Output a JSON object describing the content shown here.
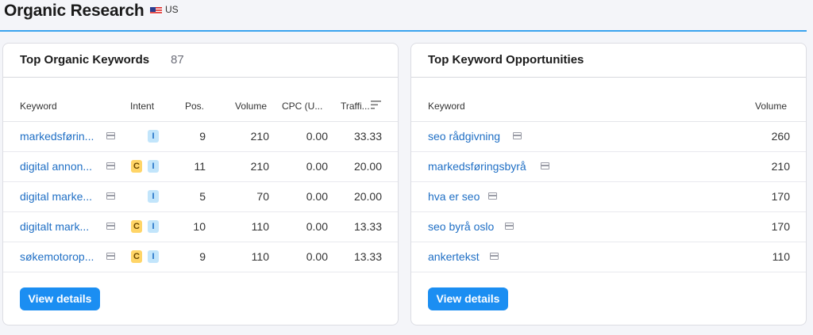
{
  "header": {
    "title": "Organic Research",
    "country": "US",
    "flag_icon": "us-flag-icon",
    "accent_color": "#3aa3ee"
  },
  "organic_keywords": {
    "title": "Top Organic Keywords",
    "count": "87",
    "columns": [
      "Keyword",
      "Intent",
      "Pos.",
      "Volume",
      "CPC (U...",
      "Traffi..."
    ],
    "rows": [
      {
        "keyword": "markedsførin...",
        "intents": [
          "I"
        ],
        "pos": "9",
        "volume": "210",
        "cpc": "0.00",
        "traffic": "33.33"
      },
      {
        "keyword": "digital annon...",
        "intents": [
          "C",
          "I"
        ],
        "pos": "11",
        "volume": "210",
        "cpc": "0.00",
        "traffic": "20.00"
      },
      {
        "keyword": "digital marke...",
        "intents": [
          "I"
        ],
        "pos": "5",
        "volume": "70",
        "cpc": "0.00",
        "traffic": "20.00"
      },
      {
        "keyword": "digitalt mark...",
        "intents": [
          "C",
          "I"
        ],
        "pos": "10",
        "volume": "110",
        "cpc": "0.00",
        "traffic": "13.33"
      },
      {
        "keyword": "søkemotorop...",
        "intents": [
          "C",
          "I"
        ],
        "pos": "9",
        "volume": "110",
        "cpc": "0.00",
        "traffic": "13.33"
      }
    ],
    "button_label": "View details"
  },
  "opportunities": {
    "title": "Top Keyword Opportunities",
    "columns": [
      "Keyword",
      "Volume"
    ],
    "rows": [
      {
        "keyword": "seo rådgivning",
        "volume": "260"
      },
      {
        "keyword": "markedsføringsbyrå",
        "volume": "210"
      },
      {
        "keyword": "hva er seo",
        "volume": "170"
      },
      {
        "keyword": "seo byrå oslo",
        "volume": "170"
      },
      {
        "keyword": "ankertekst",
        "volume": "110"
      }
    ],
    "button_label": "View details"
  }
}
